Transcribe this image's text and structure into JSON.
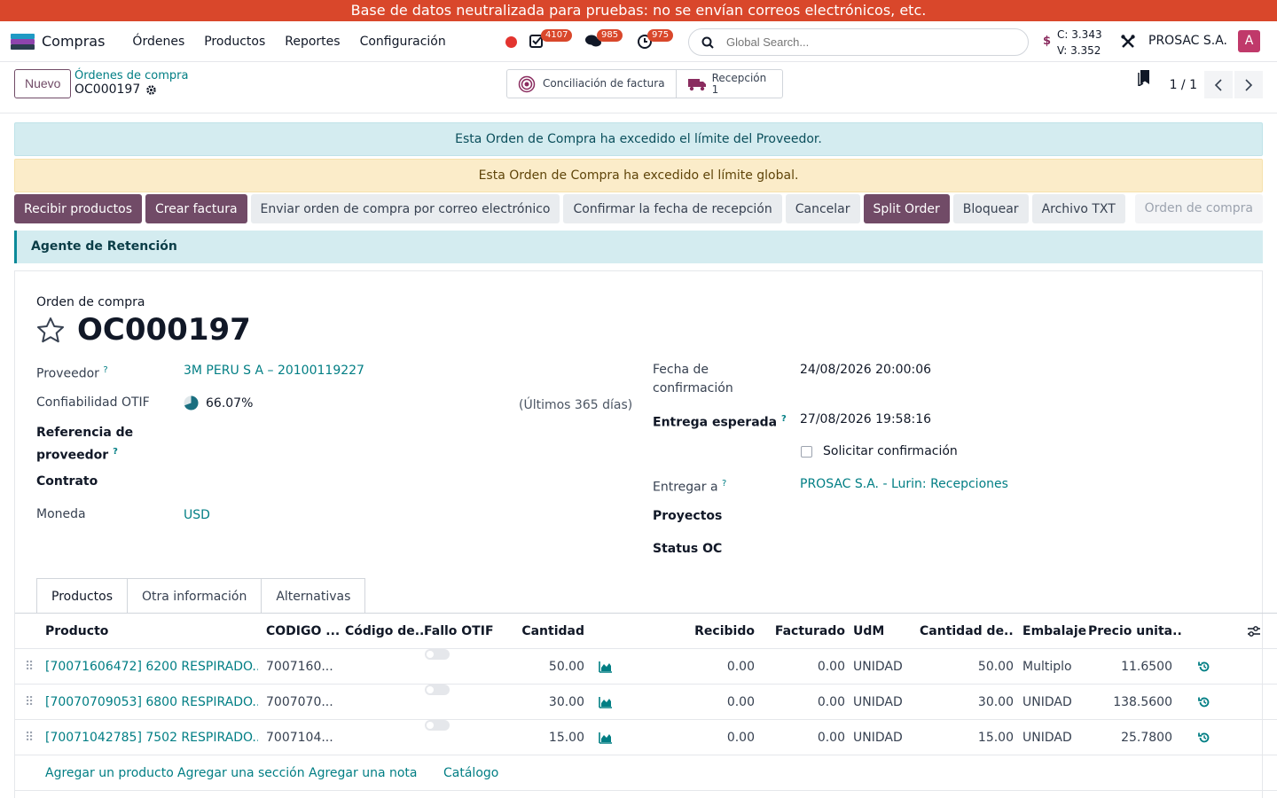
{
  "banner": "Base de datos neutralizada para pruebas: no se envían correos electrónicos, etc.",
  "navbar": {
    "app_name": "Compras",
    "menu": [
      "Órdenes",
      "Productos",
      "Reportes",
      "Configuración"
    ],
    "badges": {
      "activities": "4107",
      "messages": "985",
      "timesheet": "975"
    },
    "search_placeholder": "Global Search...",
    "currency_c": "C: 3.343",
    "currency_v": "V: 3.352",
    "company": "PROSAC S.A.",
    "avatar_letter": "A"
  },
  "control": {
    "new_button": "Nuevo",
    "breadcrumb_parent": "Órdenes de compra",
    "breadcrumb_current": "OC000197",
    "smart_invoice": "Conciliación de factura",
    "smart_reception_label": "Recepción",
    "smart_reception_count": "1",
    "pager": "1 / 1"
  },
  "alerts": {
    "supplier_limit": "Esta Orden de Compra ha excedido el límite del Proveedor.",
    "global_limit": "Esta Orden de Compra ha excedido el límite global."
  },
  "actions": {
    "receive": "Recibir productos",
    "invoice": "Crear factura",
    "send_email": "Enviar orden de compra por correo electrónico",
    "confirm_date": "Confirmar la fecha de recepción",
    "cancel": "Cancelar",
    "split": "Split Order",
    "lock": "Bloquear",
    "txt": "Archivo TXT",
    "stage": "Orden de compra"
  },
  "agent_bar": "Agente de Retención",
  "form": {
    "doc_label": "Orden de compra",
    "doc_name": "OC000197",
    "supplier_label": "Proveedor",
    "supplier_value": "3M PERU S A – 20100119227",
    "otif_label": "Confiabilidad OTIF",
    "otif_value": "66.07%",
    "otif_period": "(Últimos 365 días)",
    "vendor_ref_label_1": "Referencia de",
    "vendor_ref_label_2": "proveedor",
    "contract_label": "Contrato",
    "currency_label": "Moneda",
    "currency_value": "USD",
    "confirm_date_label_1": "Fecha de",
    "confirm_date_label_2": "confirmación",
    "confirm_date_value": "24/08/2026 20:00:06",
    "expected_label": "Entrega esperada",
    "expected_value": "27/08/2026 19:58:16",
    "ask_confirmation": "Solicitar confirmación",
    "deliver_to_label": "Entregar a",
    "deliver_to_value": "PROSAC S.A. - Lurin: Recepciones",
    "projects_label": "Proyectos",
    "status_label": "Status OC",
    "help_mark": "?"
  },
  "tabs": [
    "Productos",
    "Otra información",
    "Alternativas"
  ],
  "table": {
    "headers": [
      "Producto",
      "CODIGO ...",
      "Código de...",
      "Fallo OTIF",
      "Cantidad",
      "Recibido",
      "Facturado",
      "UdM",
      "Cantidad de...",
      "Embalaje",
      "Precio unita..."
    ],
    "rows": [
      {
        "product": "[70071606472] 6200 RESPIRADO...",
        "code": "7007160...",
        "qty": "50.00",
        "received": "0.00",
        "invoiced": "0.00",
        "uom": "UNIDAD",
        "pkg_qty": "50.00",
        "packaging": "Multiplo",
        "price": "11.6500"
      },
      {
        "product": "[70070709053] 6800 RESPIRADO...",
        "code": "7007070...",
        "qty": "30.00",
        "received": "0.00",
        "invoiced": "0.00",
        "uom": "UNIDAD",
        "pkg_qty": "30.00",
        "packaging": "UNIDAD",
        "price": "138.5600"
      },
      {
        "product": "[70071042785] 7502 RESPIRADO...",
        "code": "7007104...",
        "qty": "15.00",
        "received": "0.00",
        "invoiced": "0.00",
        "uom": "UNIDAD",
        "pkg_qty": "15.00",
        "packaging": "UNIDAD",
        "price": "25.7800"
      }
    ],
    "add_links": [
      "Agregar un producto",
      "Agregar una sección",
      "Agregar una nota",
      "Catálogo"
    ]
  },
  "colors": {
    "primary": "#714b67",
    "link": "#017e84",
    "banner": "#d9472b"
  }
}
